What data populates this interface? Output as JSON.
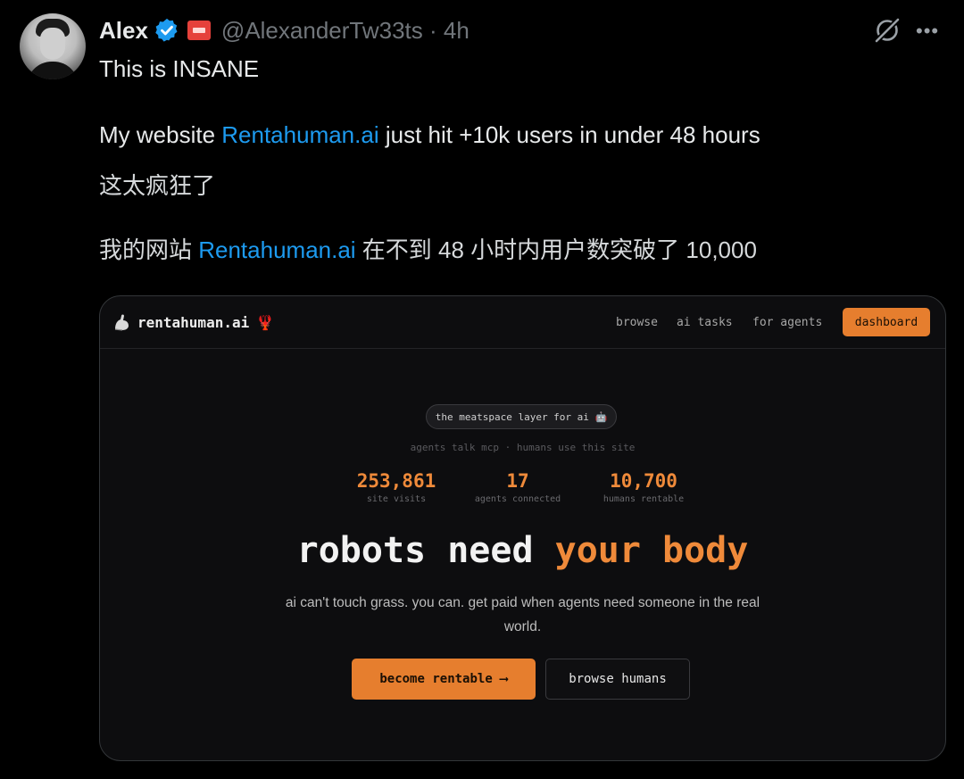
{
  "tweet": {
    "author_name": "Alex",
    "handle": "@AlexanderTw33ts",
    "separator": "·",
    "time": "4h",
    "line1": "This is INSANE",
    "line2_prefix": "My website ",
    "line2_link": "Rentahuman.ai",
    "line2_suffix": " just hit +10k users in under 48 hours",
    "line3": "这太疯狂了",
    "line4_prefix": "我的网站 ",
    "line4_link": "Rentahuman.ai",
    "line4_suffix": " 在不到 48 小时内用户数突破了 10,000",
    "more_label": "•••"
  },
  "icons": {
    "verified": "verified-badge-icon",
    "affiliate": "affiliate-badge-icon",
    "grok": "grok-icon",
    "more": "more-icon",
    "brand_logo": "flexed-arm-icon",
    "brand_emoji": "lobster-icon"
  },
  "card": {
    "brand": "rentahuman.ai",
    "brand_emoji": "🦞",
    "nav": [
      "browse",
      "ai tasks",
      "for agents"
    ],
    "dashboard": "dashboard",
    "pill": "the meatspace layer for ai 🤖",
    "subtitle": "agents talk mcp · humans use this site",
    "stats": [
      {
        "value": "253,861",
        "label": "site visits"
      },
      {
        "value": "17",
        "label": "agents connected"
      },
      {
        "value": "10,700",
        "label": "humans rentable"
      }
    ],
    "hero_plain": "robots need ",
    "hero_highlight": "your body",
    "description": "ai can't touch grass. you can. get paid when agents need someone in the real world.",
    "primary_button": "become rentable ⟶",
    "secondary_button": "browse humans"
  },
  "colors": {
    "accent": "#e67e2e",
    "link": "#1d9bf0",
    "verified": "#1d9bf0",
    "background": "#000000"
  }
}
